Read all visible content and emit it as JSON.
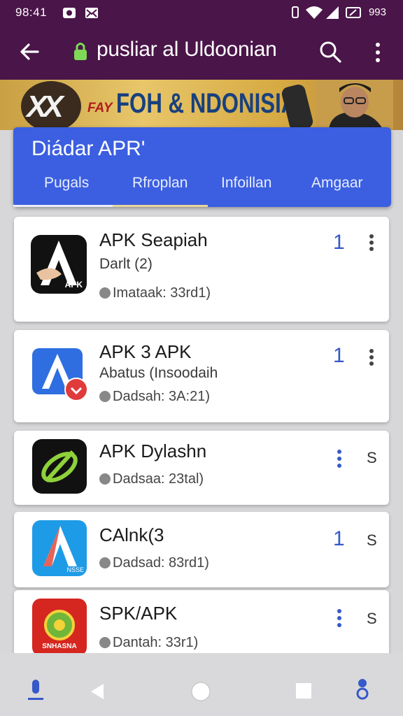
{
  "status_bar": {
    "time": "98:41",
    "battery_text": "993"
  },
  "app_bar": {
    "url": "pusliar al Uldoonian",
    "back_icon": "arrow-left-icon",
    "search_icon": "search-icon",
    "menu_icon": "more-vert-icon"
  },
  "banner": {
    "logo_text": "XX",
    "small_text": "FAY",
    "headline": "FOH & NDONISIA"
  },
  "header": {
    "title": "Diádar APR'",
    "tabs": [
      {
        "label": "Pugals"
      },
      {
        "label": "Rfroplan"
      },
      {
        "label": "Infoillan"
      },
      {
        "label": "Amgaar"
      }
    ]
  },
  "apps": [
    {
      "name": "APK Seapiah",
      "subtitle": "Darlt (2)",
      "meta": "Imataak: 33rd1)",
      "count": "1",
      "icon_label": "APK"
    },
    {
      "name": "APK 3 APK",
      "subtitle": "Abatus (Insoodaih",
      "meta": "Dadsah: 3A:21)",
      "count": "1"
    },
    {
      "name": "APK Dylashn",
      "subtitle": "",
      "meta": "Dadsaa: 23tal)",
      "count": ""
    },
    {
      "name": "CAlnk(3",
      "subtitle": "",
      "meta": "Dadsad: 83rd1)",
      "count": "1",
      "icon_label": "NSSE"
    },
    {
      "name": "SPK/APK",
      "subtitle": "",
      "meta": "Dantah: 33r1)",
      "count": "",
      "icon_label": "SNHASNA"
    }
  ],
  "colors": {
    "app_bar": "#4a1549",
    "header": "#3b5fe0",
    "accent": "#3659c9"
  }
}
